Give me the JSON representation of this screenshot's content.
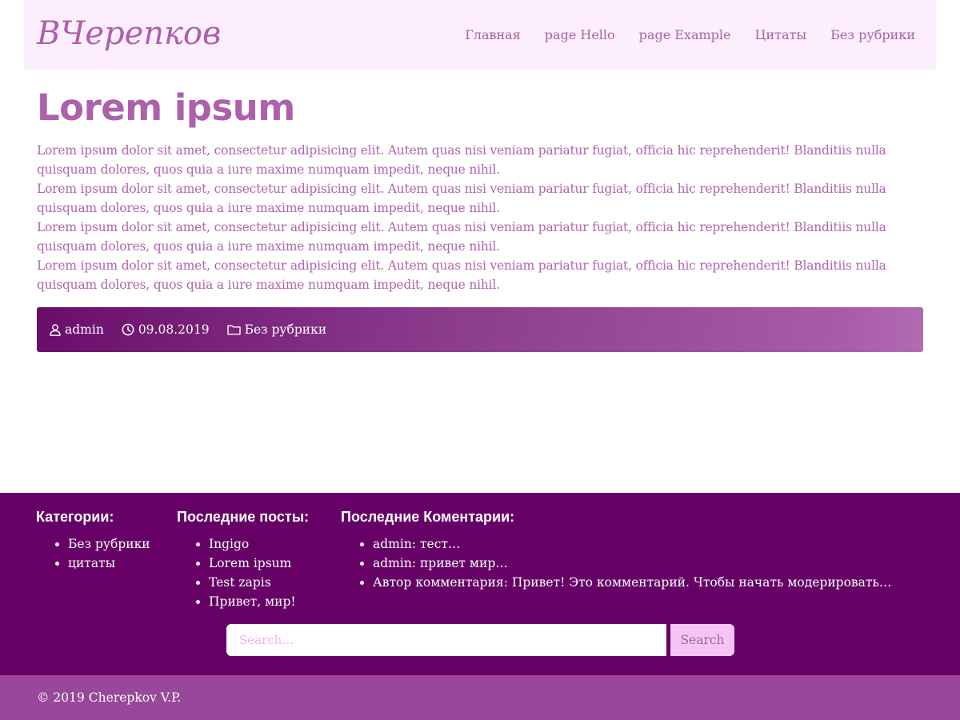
{
  "header": {
    "logo": "ВЧерепков",
    "nav": [
      "Главная",
      "page Hello",
      "page Example",
      "Цитаты",
      "Без рубрики"
    ]
  },
  "article": {
    "title": "Lorem ipsum",
    "paragraphs": [
      "Lorem ipsum dolor sit amet, consectetur adipisicing elit. Autem quas nisi veniam pariatur fugiat, officia hic reprehenderit! Blanditiis nulla quisquam dolores, quos quia a iure maxime numquam impedit, neque nihil.",
      "Lorem ipsum dolor sit amet, consectetur adipisicing elit. Autem quas nisi veniam pariatur fugiat, officia hic reprehenderit! Blanditiis nulla quisquam dolores, quos quia a iure maxime numquam impedit, neque nihil.",
      "Lorem ipsum dolor sit amet, consectetur adipisicing elit. Autem quas nisi veniam pariatur fugiat, officia hic reprehenderit! Blanditiis nulla quisquam dolores, quos quia a iure maxime numquam impedit, neque nihil.",
      "Lorem ipsum dolor sit amet, consectetur adipisicing elit. Autem quas nisi veniam pariatur fugiat, officia hic reprehenderit! Blanditiis nulla quisquam dolores, quos quia a iure maxime numquam impedit, neque nihil."
    ],
    "meta": {
      "author": "admin",
      "author_icon": "user-icon",
      "date": "09.08.2019",
      "date_icon": "clock-icon",
      "category": "Без рубрики",
      "category_icon": "folder-icon"
    }
  },
  "footer": {
    "categories": {
      "heading": "Категории:",
      "items": [
        "Без рубрики",
        "цитаты"
      ]
    },
    "recent_posts": {
      "heading": "Последние посты:",
      "items": [
        "Ingigo",
        "Lorem ipsum",
        "Test zapis",
        "Привет, мир!"
      ]
    },
    "recent_comments": {
      "heading": "Последние Коментарии:",
      "items": [
        "admin: тест…",
        "admin: привет мир…",
        "Автор комментария: Привет! Это комментарий. Чтобы начать модерировать…"
      ]
    },
    "search": {
      "placeholder": "Search…",
      "button": "Search"
    },
    "copyright": "© 2019 Cherepkov V.P."
  },
  "colors": {
    "accent": "#ad5fa9",
    "header_bg": "#fdeefd",
    "footer_bg": "#660066",
    "copyright_bg": "#98479a",
    "search_button_bg": "#f6c4f3"
  }
}
